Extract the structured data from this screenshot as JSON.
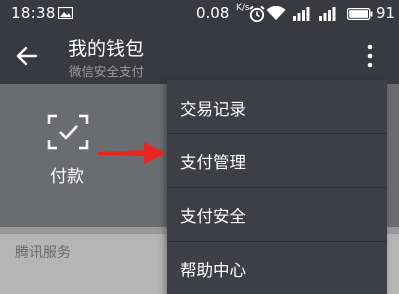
{
  "status_bar": {
    "time": "18:38",
    "speed": "0.08",
    "speed_unit": "K/s",
    "battery": "91",
    "icons": [
      "image-icon",
      "alarm-icon",
      "wifi-icon",
      "signal-icon",
      "signal-icon",
      "battery-icon"
    ]
  },
  "app_bar": {
    "title": "我的钱包",
    "subtitle": "微信安全支付",
    "icons": [
      "back-arrow-icon",
      "more-vertical-icon"
    ]
  },
  "wallet": {
    "pay_label": "付款",
    "pay_icon": "scan-check-icon"
  },
  "services": {
    "label": "腾讯服务"
  },
  "menu": {
    "items": [
      {
        "label": "交易记录"
      },
      {
        "label": "支付管理"
      },
      {
        "label": "支付安全"
      },
      {
        "label": "帮助中心"
      }
    ]
  },
  "annotation": {
    "arrow_color": "#e8251f",
    "arrow_icon": "red-arrow-icon"
  },
  "colors": {
    "app_bar": "#393a3f",
    "menu": "#3e3f44",
    "dimmed_panel": "#6b6c70"
  }
}
